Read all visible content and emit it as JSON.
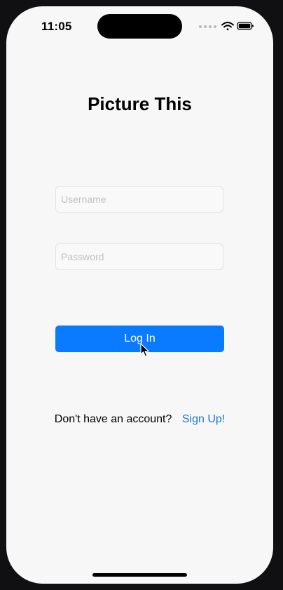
{
  "status_bar": {
    "time": "11:05",
    "icons": [
      "signal-dots-icon",
      "wifi-icon",
      "battery-icon"
    ]
  },
  "app": {
    "title": "Picture This"
  },
  "form": {
    "username_placeholder": "Username",
    "username_value": "",
    "password_placeholder": "Password",
    "password_value": "",
    "login_label": "Log In"
  },
  "footer": {
    "prompt": "Don't have an account?",
    "signup_label": "Sign Up!"
  },
  "colors": {
    "accent": "#0a7bff",
    "link": "#1977d4",
    "background": "#f7f7f7"
  }
}
